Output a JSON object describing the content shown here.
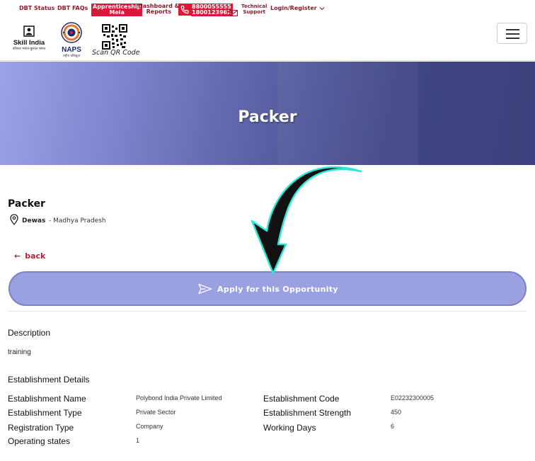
{
  "topnav": {
    "dbt_status": "DBT Status",
    "dbt_faqs": "DBT FAQs",
    "apprenticeship_mela_1": "Apprenticeship",
    "apprenticeship_mela_2": "Mela",
    "dashboard_1": "Dashboard &",
    "dashboard_2": "Reports",
    "phone_1": "8800055555",
    "phone_2": "1800123962",
    "tech_support_1": "Technical",
    "tech_support_2": "Support",
    "login": "Login/Register"
  },
  "logos": {
    "skill_india_name": "Skill India",
    "skill_india_sub": "कौशल भारत-कुशल भारत",
    "naps_name": "NAPS",
    "naps_sub": "राष्ट्रीय प्रशिक्षुता",
    "qr_label": "Scan QR Code"
  },
  "banner": {
    "title": "Packer"
  },
  "job": {
    "title": "Packer",
    "city": "Dewas",
    "state": "- Madhya Pradesh"
  },
  "back_label": "back",
  "apply_label": "Apply for this Opportunity",
  "description": {
    "heading": "Description",
    "text": "training"
  },
  "establishment": {
    "heading": "Establishment Details",
    "rows_left": [
      {
        "label": "Establishment Name",
        "value": "Polybond India Private Limited"
      },
      {
        "label": "Establishment Type",
        "value": "Private Sector"
      },
      {
        "label": "Registration Type",
        "value": "Company"
      },
      {
        "label": "Operating states",
        "value": "1"
      }
    ],
    "rows_right": [
      {
        "label": "Establishment Code",
        "value": "E02232300005"
      },
      {
        "label": "Establishment Strength",
        "value": "450"
      },
      {
        "label": "Working Days",
        "value": "6"
      }
    ]
  },
  "colors": {
    "nav_red": "#8c1c2b",
    "badge_red": "#d9183a",
    "banner_dark": "#3e4380",
    "banner_light": "#9da3e8",
    "apply_button": "#9ba0e0",
    "back_link": "#b0263b"
  },
  "icons": [
    "phone-icon",
    "mail-icon",
    "chevron-down-icon",
    "menu-icon",
    "location-pin-icon",
    "arrow-left-icon",
    "send-icon"
  ]
}
